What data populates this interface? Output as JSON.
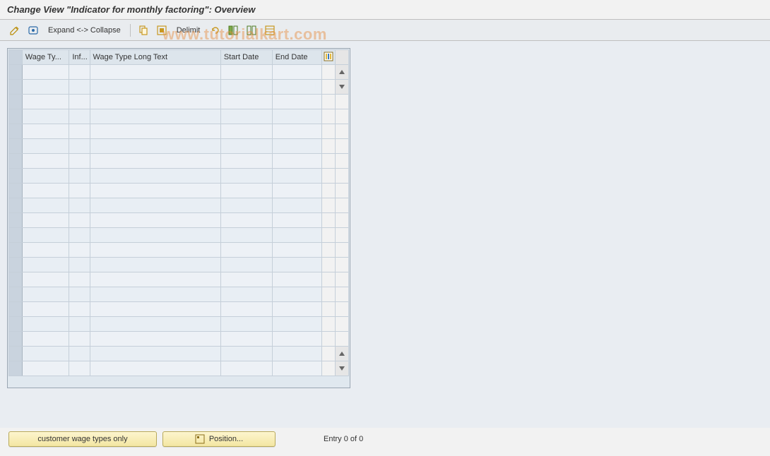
{
  "title": "Change View \"Indicator for monthly factoring\": Overview",
  "toolbar": {
    "expand_collapse": "Expand <-> Collapse",
    "delimit": "Delimit"
  },
  "table": {
    "headers": {
      "wage_type": "Wage Ty...",
      "inf": "Inf...",
      "long_text": "Wage Type Long Text",
      "start": "Start Date",
      "end": "End Date"
    },
    "row_count": 21
  },
  "footer": {
    "customer_btn": "customer wage types only",
    "position_btn": "Position...",
    "entry_text": "Entry 0 of 0"
  },
  "watermark": "www.tutorialkart.com"
}
